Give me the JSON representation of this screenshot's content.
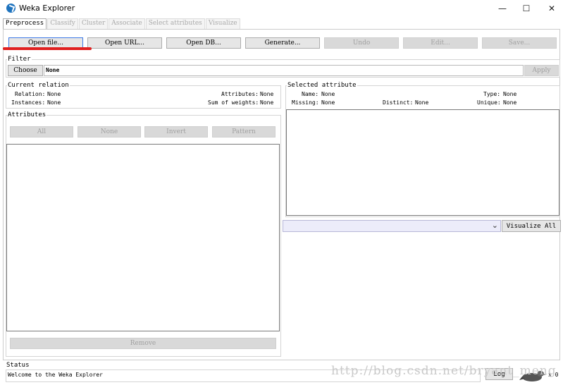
{
  "window": {
    "title": "Weka Explorer",
    "minimize": "—",
    "maximize": "☐",
    "close": "✕"
  },
  "tabs": [
    "Preprocess",
    "Classify",
    "Cluster",
    "Associate",
    "Select attributes",
    "Visualize"
  ],
  "toolbar": {
    "open_file": "Open file...",
    "open_url": "Open URL...",
    "open_db": "Open DB...",
    "generate": "Generate...",
    "undo": "Undo",
    "edit": "Edit...",
    "save": "Save..."
  },
  "filter": {
    "title": "Filter",
    "choose": "Choose",
    "value": "None",
    "apply": "Apply"
  },
  "current_relation": {
    "title": "Current relation",
    "relation_label": "Relation:",
    "relation_value": "None",
    "instances_label": "Instances:",
    "instances_value": "None",
    "attributes_label": "Attributes:",
    "attributes_value": "None",
    "sum_weights_label": "Sum of weights:",
    "sum_weights_value": "None"
  },
  "attributes": {
    "title": "Attributes",
    "all": "All",
    "none": "None",
    "invert": "Invert",
    "pattern": "Pattern",
    "remove": "Remove"
  },
  "selected_attribute": {
    "title": "Selected attribute",
    "name_label": "Name:",
    "name_value": "None",
    "type_label": "Type:",
    "type_value": "None",
    "missing_label": "Missing:",
    "missing_value": "None",
    "distinct_label": "Distinct:",
    "distinct_value": "None",
    "unique_label": "Unique:",
    "unique_value": "None"
  },
  "visualize_all": "Visualize All",
  "status": {
    "title": "Status",
    "message": "Welcome to the Weka Explorer",
    "log": "Log",
    "count": "x 0"
  },
  "watermark": "http://blog.csdn.net/bryant_meng"
}
